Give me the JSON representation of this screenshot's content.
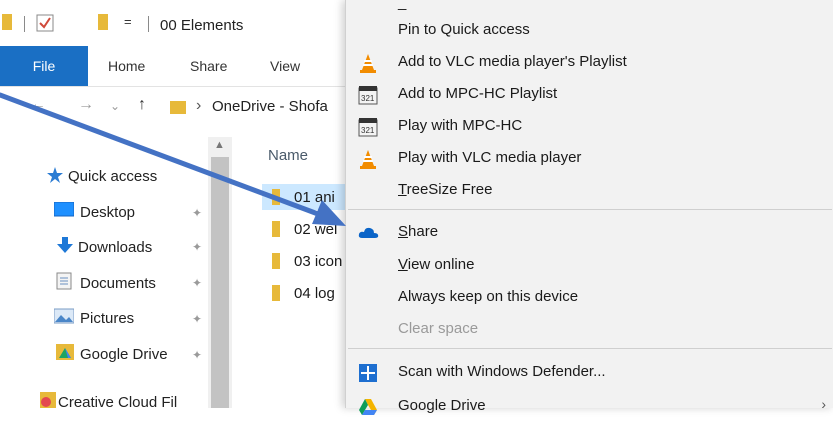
{
  "window": {
    "title": "00 Elements",
    "quick_access_toolbar": {
      "dropdown_glyph": "="
    }
  },
  "ribbon": {
    "tabs": [
      {
        "label": "File"
      },
      {
        "label": "Home"
      },
      {
        "label": "Share"
      },
      {
        "label": "View"
      }
    ]
  },
  "address_bar": {
    "path": "OneDrive - Shofa"
  },
  "nav_pane": {
    "items": [
      {
        "label": "Quick access",
        "icon": "star-icon"
      },
      {
        "label": "Desktop",
        "icon": "desktop-icon",
        "pinned": true
      },
      {
        "label": "Downloads",
        "icon": "download-arrow-icon",
        "pinned": true
      },
      {
        "label": "Documents",
        "icon": "documents-icon",
        "pinned": true
      },
      {
        "label": "Pictures",
        "icon": "pictures-icon",
        "pinned": true
      },
      {
        "label": "Google Drive",
        "icon": "google-drive-icon",
        "pinned": true
      },
      {
        "label": "Creative Cloud Fil",
        "icon": "creative-cloud-icon"
      }
    ]
  },
  "file_list": {
    "column_header": "Name",
    "rows": [
      {
        "name": "01 ani",
        "selected": true
      },
      {
        "name": "02 wel",
        "selected": false
      },
      {
        "name": "03 icon",
        "selected": false
      },
      {
        "name": "04 log",
        "selected": false
      }
    ]
  },
  "context_menu": {
    "partial_top_text": "_",
    "items": [
      {
        "label": "Pin to Quick access",
        "icon": ""
      },
      {
        "label": "Add to VLC media player's Playlist",
        "icon": "vlc-cone-icon"
      },
      {
        "label": "Add to MPC-HC Playlist",
        "icon": "mpc-hc-icon"
      },
      {
        "label": "Play with MPC-HC",
        "icon": "mpc-hc-icon"
      },
      {
        "label": "Play with VLC media player",
        "icon": "vlc-cone-icon"
      },
      {
        "label": "TreeSize Free",
        "icon": "",
        "accelerator": "T"
      },
      {
        "label": "Share",
        "icon": "onedrive-cloud-icon",
        "accelerator": "S"
      },
      {
        "label": "View online",
        "icon": "",
        "accelerator": "V"
      },
      {
        "label": "Always keep on this device",
        "icon": ""
      },
      {
        "label": "Clear space",
        "icon": "",
        "disabled": true
      },
      {
        "label": "Scan with Windows Defender...",
        "icon": "windows-defender-icon"
      },
      {
        "label": "Google Drive",
        "icon": "google-drive-icon",
        "has_submenu": true
      }
    ]
  },
  "colors": {
    "file_tab_blue": "#1a6fc4",
    "annotation_arrow": "#4472c4",
    "selected_row": "#cce8ff",
    "folder_yellow": "#e7b93a",
    "menu_bg": "#f2f2f2",
    "disabled_text": "#9a9a9a"
  }
}
